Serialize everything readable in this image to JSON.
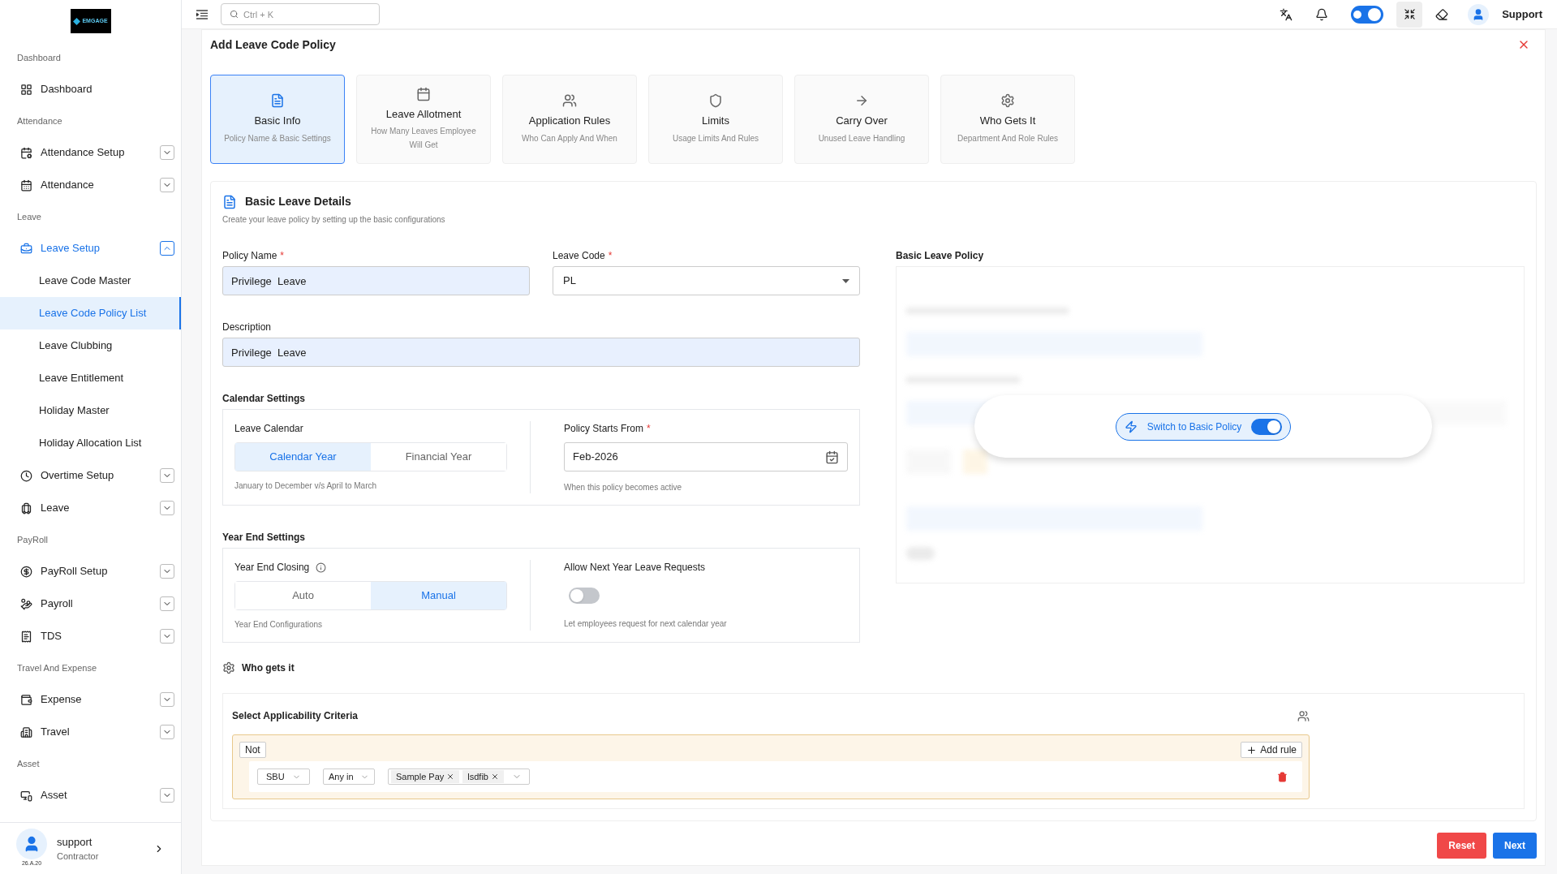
{
  "sidebar": {
    "logo": "EMGAGE",
    "sections": [
      {
        "title": "Dashboard",
        "items": [
          {
            "label": "Dashboard"
          }
        ]
      },
      {
        "title": "Attendance",
        "items": [
          {
            "label": "Attendance Setup",
            "expanded": false
          },
          {
            "label": "Attendance",
            "expanded": false
          }
        ]
      },
      {
        "title": "Leave",
        "items": [
          {
            "label": "Leave Setup",
            "expanded": true,
            "children": [
              {
                "label": "Leave Code Master",
                "selected": false
              },
              {
                "label": "Leave Code Policy List",
                "selected": true
              },
              {
                "label": "Leave Clubbing",
                "selected": false
              },
              {
                "label": "Leave Entitlement",
                "selected": false
              },
              {
                "label": "Holiday Master",
                "selected": false
              },
              {
                "label": "Holiday Allocation List",
                "selected": false
              }
            ]
          },
          {
            "label": "Overtime Setup",
            "expanded": false
          },
          {
            "label": "Leave",
            "expanded": false
          }
        ]
      },
      {
        "title": "PayRoll",
        "items": [
          {
            "label": "PayRoll Setup",
            "expanded": false
          },
          {
            "label": "Payroll",
            "expanded": false
          },
          {
            "label": "TDS",
            "expanded": false
          }
        ]
      },
      {
        "title": "Travel And Expense",
        "items": [
          {
            "label": "Expense",
            "expanded": false
          },
          {
            "label": "Travel",
            "expanded": false
          }
        ]
      },
      {
        "title": "Asset",
        "items": [
          {
            "label": "Asset",
            "expanded": false
          }
        ]
      }
    ],
    "user": {
      "name": "support",
      "role": "Contractor",
      "version": "26.A.20"
    }
  },
  "header": {
    "search_placeholder": "Ctrl + K",
    "theme_toggle_on": true,
    "user": "Support"
  },
  "page_title": "Add Leave Code Policy",
  "steps": [
    {
      "title": "Basic Info",
      "subtitle": "Policy Name & Basic Settings",
      "selected": true
    },
    {
      "title": "Leave Allotment",
      "subtitle": "How Many Leaves Employee Will Get",
      "selected": false
    },
    {
      "title": "Application Rules",
      "subtitle": "Who Can Apply And When",
      "selected": false
    },
    {
      "title": "Limits",
      "subtitle": "Usage Limits And Rules",
      "selected": false
    },
    {
      "title": "Carry Over",
      "subtitle": "Unused Leave Handling",
      "selected": false
    },
    {
      "title": "Who Gets It",
      "subtitle": "Department And Role Rules",
      "selected": false
    }
  ],
  "details": {
    "title": "Basic Leave Details",
    "subtitle": "Create your leave policy by setting up the basic configurations",
    "policy_name": {
      "label": "Policy Name",
      "required_mark": "*",
      "value": "Privilege  Leave"
    },
    "leave_code": {
      "label": "Leave Code",
      "required_mark": "*",
      "value": "PL"
    },
    "description": {
      "label": "Description",
      "value": "Privilege  Leave"
    },
    "calendar_settings": {
      "title": "Calendar Settings",
      "leave_calendar": {
        "label": "Leave Calendar",
        "options": [
          {
            "label": "Calendar Year",
            "selected": true
          },
          {
            "label": "Financial Year",
            "selected": false
          }
        ],
        "hint": "January to December v/s April to March"
      },
      "policy_starts_from": {
        "label": "Policy Starts From",
        "required_mark": "*",
        "value": "Feb-2026",
        "hint": "When this policy becomes active"
      }
    },
    "year_end_settings": {
      "title": "Year End Settings",
      "year_end_closing": {
        "label": "Year End Closing",
        "options": [
          {
            "label": "Auto",
            "selected": false
          },
          {
            "label": "Manual",
            "selected": true
          }
        ],
        "hint": "Year End Configurations"
      },
      "allow_next_year": {
        "label": "Allow Next Year Leave Requests",
        "on": false,
        "hint": "Let employees request for next calendar year"
      }
    },
    "basic_policy": {
      "title": "Basic Leave Policy",
      "switch_label": "Switch to Basic Policy",
      "on": true
    },
    "who_gets_it": {
      "title": "Who gets it"
    },
    "criteria": {
      "title": "Select Applicability Criteria",
      "not_label": "Not",
      "add_rule": "Add rule",
      "rule": {
        "field": "SBU",
        "operator": "Any in",
        "tags": [
          "Sample Pay",
          "lsdfib"
        ]
      }
    }
  },
  "buttons": {
    "reset": "Reset",
    "next": "Next"
  }
}
